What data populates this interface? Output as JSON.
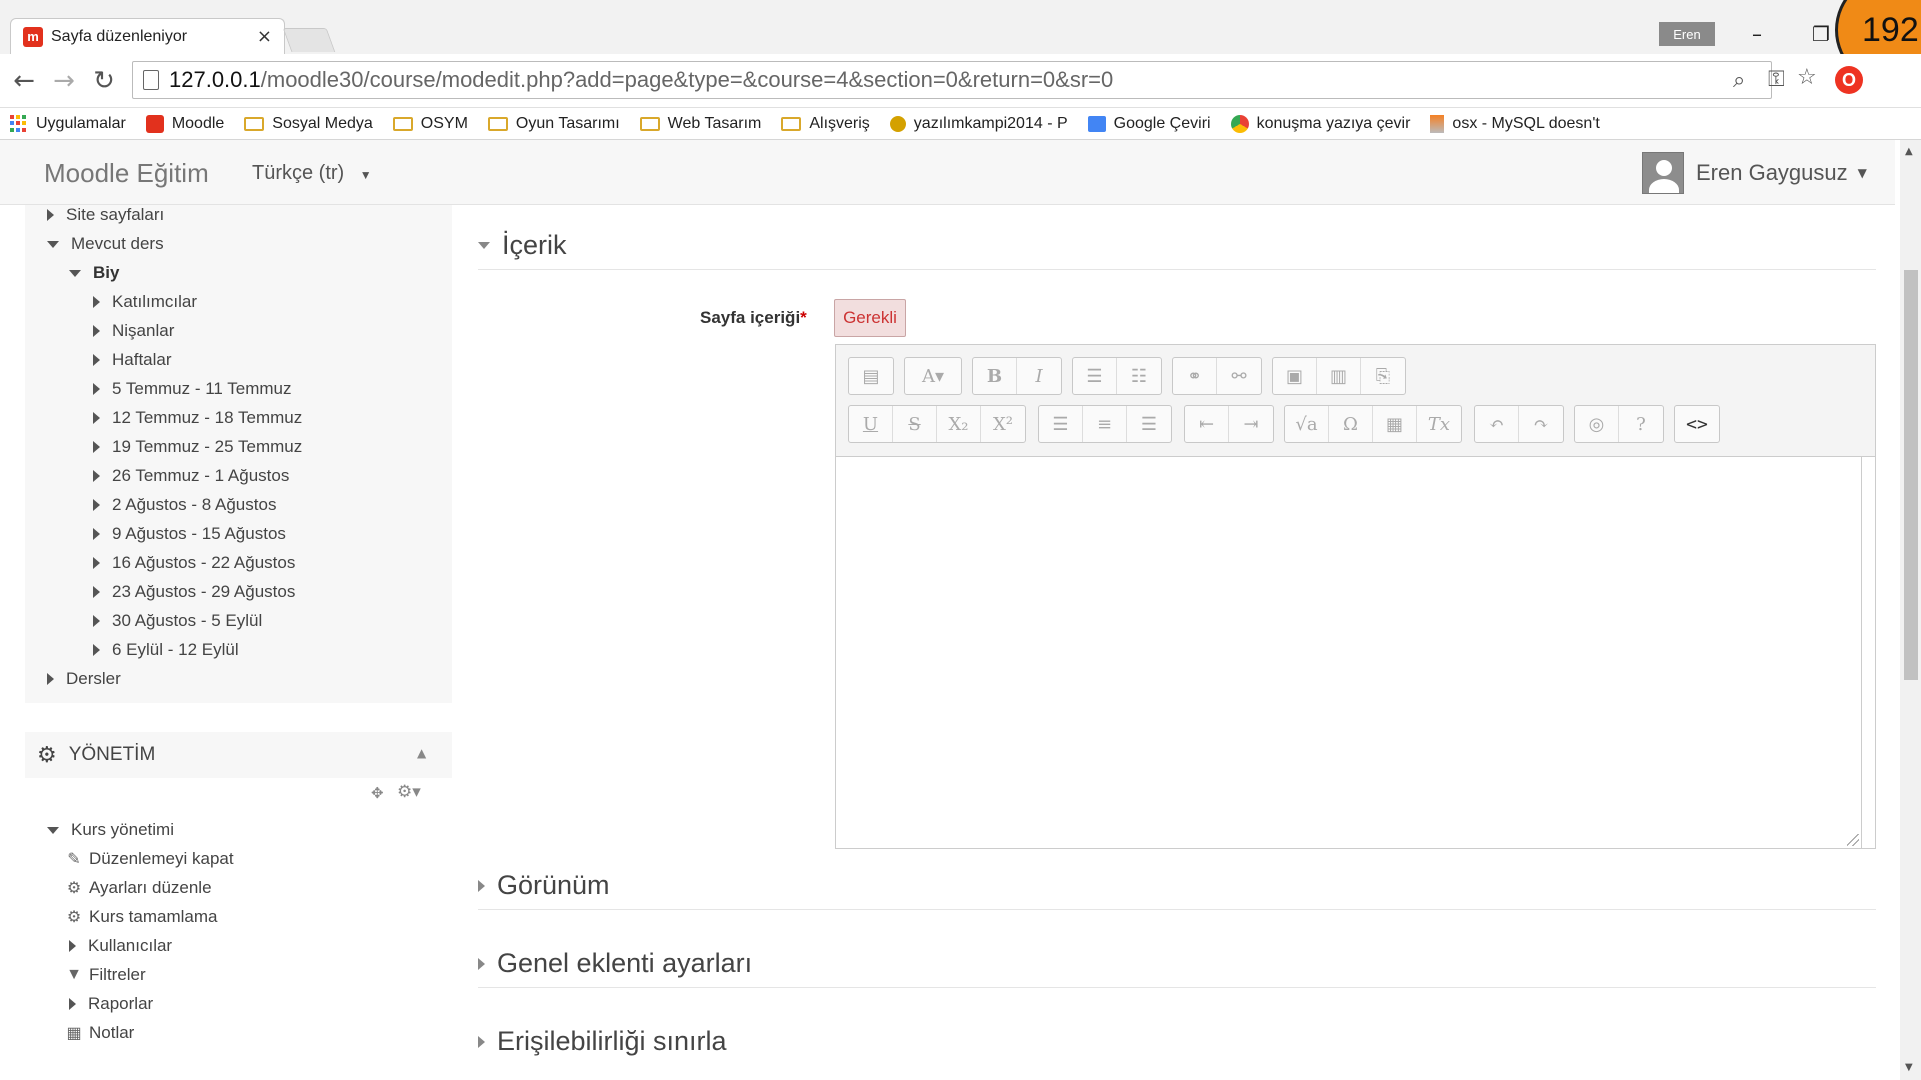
{
  "browser": {
    "tab_title": "Sayfa düzenleniyor",
    "tab_close": "×",
    "favicon_letter": "m",
    "profile_name": "Eren",
    "minimize": "–",
    "restore": "❐",
    "badge_number": "192",
    "url_host": "127.0.0.1",
    "url_path": "/moodle30/course/modedit.php?add=page&type=&course=4&section=0&return=0&sr=0",
    "bookmarks": [
      {
        "label": "Uygulamalar",
        "icon": "apps-icon"
      },
      {
        "label": "Moodle",
        "icon": "moodle-icon"
      },
      {
        "label": "Sosyal Medya",
        "icon": "folder-icon"
      },
      {
        "label": "OSYM",
        "icon": "folder-icon"
      },
      {
        "label": "Oyun Tasarımı",
        "icon": "folder-icon"
      },
      {
        "label": "Web Tasarım",
        "icon": "folder-icon"
      },
      {
        "label": "Alışveriş",
        "icon": "folder-icon"
      },
      {
        "label": "yazılımkampi2014 - P",
        "icon": "bug-icon"
      },
      {
        "label": "Google Çeviri",
        "icon": "translate-icon"
      },
      {
        "label": "konuşma yazıya çevir",
        "icon": "chrome-icon"
      },
      {
        "label": "osx - MySQL doesn't",
        "icon": "stackoverflow-icon"
      }
    ]
  },
  "navbar": {
    "brand": "Moodle Eğitim",
    "language": "Türkçe (tr)",
    "user_name": "Eren Gaygusuz"
  },
  "nav_tree": [
    {
      "label": "Site sayfaları",
      "state": "collapsed",
      "level": 0
    },
    {
      "label": "Mevcut ders",
      "state": "expanded",
      "level": 0
    },
    {
      "label": "Biy",
      "state": "expanded",
      "level": 1,
      "bold": true
    },
    {
      "label": "Katılımcılar",
      "state": "collapsed",
      "level": 2
    },
    {
      "label": "Nişanlar",
      "state": "collapsed",
      "level": 2
    },
    {
      "label": "Haftalar",
      "state": "collapsed",
      "level": 2
    },
    {
      "label": "5 Temmuz - 11 Temmuz",
      "state": "collapsed",
      "level": 2
    },
    {
      "label": "12 Temmuz - 18 Temmuz",
      "state": "collapsed",
      "level": 2
    },
    {
      "label": "19 Temmuz - 25 Temmuz",
      "state": "collapsed",
      "level": 2
    },
    {
      "label": "26 Temmuz - 1 Ağustos",
      "state": "collapsed",
      "level": 2
    },
    {
      "label": "2 Ağustos - 8 Ağustos",
      "state": "collapsed",
      "level": 2
    },
    {
      "label": "9 Ağustos - 15 Ağustos",
      "state": "collapsed",
      "level": 2
    },
    {
      "label": "16 Ağustos - 22 Ağustos",
      "state": "collapsed",
      "level": 2
    },
    {
      "label": "23 Ağustos - 29 Ağustos",
      "state": "collapsed",
      "level": 2
    },
    {
      "label": "30 Ağustos - 5 Eylül",
      "state": "collapsed",
      "level": 2
    },
    {
      "label": "6 Eylül - 12 Eylül",
      "state": "collapsed",
      "level": 2
    },
    {
      "label": "Dersler",
      "state": "collapsed",
      "level": 0
    }
  ],
  "admin": {
    "title": "YÖNETİM",
    "items": [
      {
        "label": "Kurs yönetimi",
        "state": "expanded",
        "level": 0
      },
      {
        "label": "Düzenlemeyi kapat",
        "icon": "pencil-icon",
        "level": 1
      },
      {
        "label": "Ayarları düzenle",
        "icon": "gear-icon",
        "level": 1
      },
      {
        "label": "Kurs tamamlama",
        "icon": "gear-icon",
        "level": 1
      },
      {
        "label": "Kullanıcılar",
        "state": "collapsed",
        "level": 1
      },
      {
        "label": "Filtreler",
        "icon": "filter-icon",
        "level": 1
      },
      {
        "label": "Raporlar",
        "state": "collapsed",
        "level": 1
      },
      {
        "label": "Notlar",
        "icon": "table-icon",
        "level": 1
      }
    ]
  },
  "form": {
    "section_content": "İçerik",
    "field_label": "Sayfa içeriği",
    "required_star": "*",
    "required_badge": "Gerekli",
    "collapsed_sections": [
      "Görünüm",
      "Genel eklenti ayarları",
      "Erişilebilirliği sınırla"
    ]
  },
  "editor_toolbar": {
    "row1": [
      [
        "toggle-toolbar-icon"
      ],
      [
        "font-style-icon"
      ],
      [
        "bold-icon",
        "italic-icon"
      ],
      [
        "bullet-list-icon",
        "numbered-list-icon"
      ],
      [
        "link-icon",
        "unlink-icon"
      ],
      [
        "image-icon",
        "media-icon",
        "paste-icon"
      ]
    ],
    "row2": [
      [
        "underline-icon",
        "strikethrough-icon",
        "subscript-icon",
        "superscript-icon"
      ],
      [
        "align-left-icon",
        "align-center-icon",
        "align-right-icon"
      ],
      [
        "outdent-icon",
        "indent-icon"
      ],
      [
        "equation-icon",
        "special-char-icon",
        "table-icon",
        "clear-format-icon"
      ],
      [
        "undo-icon",
        "redo-icon"
      ],
      [
        "accessibility-checker-icon",
        "screenreader-helper-icon"
      ],
      [
        "html-source-icon"
      ]
    ]
  }
}
